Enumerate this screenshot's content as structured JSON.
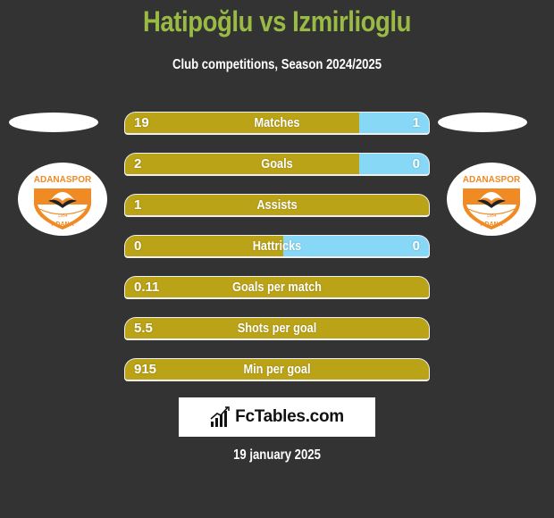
{
  "header": {
    "title": "Hatipoğlu vs Izmirlioglu",
    "subtitle": "Club competitions, Season 2024/2025"
  },
  "teams": {
    "left": {
      "logo": "adanaspor-logo-icon",
      "badge_text_top": "ADANASPOR",
      "badge_text_bottom": "ADANA",
      "badge_year": "1954"
    },
    "right": {
      "logo": "adanaspor-logo-icon",
      "badge_text_top": "ADANASPOR",
      "badge_text_bottom": "ADANA",
      "badge_year": "1954"
    }
  },
  "stats": [
    {
      "label": "Matches",
      "left": "19",
      "right": "1",
      "left_share": 0.77
    },
    {
      "label": "Goals",
      "left": "2",
      "right": "0",
      "left_share": 0.77
    },
    {
      "label": "Assists",
      "left": "1",
      "right": "",
      "left_share": 1.0
    },
    {
      "label": "Hattricks",
      "left": "0",
      "right": "0",
      "left_share": 0.52
    },
    {
      "label": "Goals per match",
      "left": "0.11",
      "right": "",
      "left_share": 1.0
    },
    {
      "label": "Shots per goal",
      "left": "5.5",
      "right": "",
      "left_share": 1.0
    },
    {
      "label": "Min per goal",
      "left": "915",
      "right": "",
      "left_share": 1.0
    }
  ],
  "colors": {
    "title": "#99bb44",
    "left_bar": "#bba317",
    "right_bar": "#87d8f7",
    "background": "#333333",
    "badge_orange": "#f08a24"
  },
  "brand": {
    "name": "FcTables.com",
    "icon": "bar-chart-icon"
  },
  "footer": {
    "date": "19 january 2025"
  }
}
